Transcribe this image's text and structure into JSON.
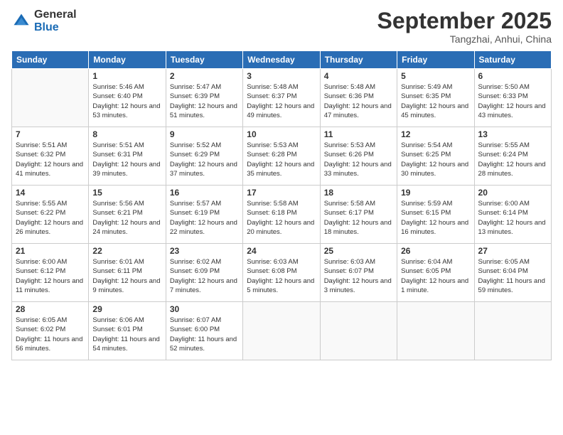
{
  "logo": {
    "general": "General",
    "blue": "Blue"
  },
  "title": "September 2025",
  "subtitle": "Tangzhai, Anhui, China",
  "days_header": [
    "Sunday",
    "Monday",
    "Tuesday",
    "Wednesday",
    "Thursday",
    "Friday",
    "Saturday"
  ],
  "weeks": [
    [
      {
        "num": "",
        "info": ""
      },
      {
        "num": "1",
        "info": "Sunrise: 5:46 AM\nSunset: 6:40 PM\nDaylight: 12 hours\nand 53 minutes."
      },
      {
        "num": "2",
        "info": "Sunrise: 5:47 AM\nSunset: 6:39 PM\nDaylight: 12 hours\nand 51 minutes."
      },
      {
        "num": "3",
        "info": "Sunrise: 5:48 AM\nSunset: 6:37 PM\nDaylight: 12 hours\nand 49 minutes."
      },
      {
        "num": "4",
        "info": "Sunrise: 5:48 AM\nSunset: 6:36 PM\nDaylight: 12 hours\nand 47 minutes."
      },
      {
        "num": "5",
        "info": "Sunrise: 5:49 AM\nSunset: 6:35 PM\nDaylight: 12 hours\nand 45 minutes."
      },
      {
        "num": "6",
        "info": "Sunrise: 5:50 AM\nSunset: 6:33 PM\nDaylight: 12 hours\nand 43 minutes."
      }
    ],
    [
      {
        "num": "7",
        "info": "Sunrise: 5:51 AM\nSunset: 6:32 PM\nDaylight: 12 hours\nand 41 minutes."
      },
      {
        "num": "8",
        "info": "Sunrise: 5:51 AM\nSunset: 6:31 PM\nDaylight: 12 hours\nand 39 minutes."
      },
      {
        "num": "9",
        "info": "Sunrise: 5:52 AM\nSunset: 6:29 PM\nDaylight: 12 hours\nand 37 minutes."
      },
      {
        "num": "10",
        "info": "Sunrise: 5:53 AM\nSunset: 6:28 PM\nDaylight: 12 hours\nand 35 minutes."
      },
      {
        "num": "11",
        "info": "Sunrise: 5:53 AM\nSunset: 6:26 PM\nDaylight: 12 hours\nand 33 minutes."
      },
      {
        "num": "12",
        "info": "Sunrise: 5:54 AM\nSunset: 6:25 PM\nDaylight: 12 hours\nand 30 minutes."
      },
      {
        "num": "13",
        "info": "Sunrise: 5:55 AM\nSunset: 6:24 PM\nDaylight: 12 hours\nand 28 minutes."
      }
    ],
    [
      {
        "num": "14",
        "info": "Sunrise: 5:55 AM\nSunset: 6:22 PM\nDaylight: 12 hours\nand 26 minutes."
      },
      {
        "num": "15",
        "info": "Sunrise: 5:56 AM\nSunset: 6:21 PM\nDaylight: 12 hours\nand 24 minutes."
      },
      {
        "num": "16",
        "info": "Sunrise: 5:57 AM\nSunset: 6:19 PM\nDaylight: 12 hours\nand 22 minutes."
      },
      {
        "num": "17",
        "info": "Sunrise: 5:58 AM\nSunset: 6:18 PM\nDaylight: 12 hours\nand 20 minutes."
      },
      {
        "num": "18",
        "info": "Sunrise: 5:58 AM\nSunset: 6:17 PM\nDaylight: 12 hours\nand 18 minutes."
      },
      {
        "num": "19",
        "info": "Sunrise: 5:59 AM\nSunset: 6:15 PM\nDaylight: 12 hours\nand 16 minutes."
      },
      {
        "num": "20",
        "info": "Sunrise: 6:00 AM\nSunset: 6:14 PM\nDaylight: 12 hours\nand 13 minutes."
      }
    ],
    [
      {
        "num": "21",
        "info": "Sunrise: 6:00 AM\nSunset: 6:12 PM\nDaylight: 12 hours\nand 11 minutes."
      },
      {
        "num": "22",
        "info": "Sunrise: 6:01 AM\nSunset: 6:11 PM\nDaylight: 12 hours\nand 9 minutes."
      },
      {
        "num": "23",
        "info": "Sunrise: 6:02 AM\nSunset: 6:09 PM\nDaylight: 12 hours\nand 7 minutes."
      },
      {
        "num": "24",
        "info": "Sunrise: 6:03 AM\nSunset: 6:08 PM\nDaylight: 12 hours\nand 5 minutes."
      },
      {
        "num": "25",
        "info": "Sunrise: 6:03 AM\nSunset: 6:07 PM\nDaylight: 12 hours\nand 3 minutes."
      },
      {
        "num": "26",
        "info": "Sunrise: 6:04 AM\nSunset: 6:05 PM\nDaylight: 12 hours\nand 1 minute."
      },
      {
        "num": "27",
        "info": "Sunrise: 6:05 AM\nSunset: 6:04 PM\nDaylight: 11 hours\nand 59 minutes."
      }
    ],
    [
      {
        "num": "28",
        "info": "Sunrise: 6:05 AM\nSunset: 6:02 PM\nDaylight: 11 hours\nand 56 minutes."
      },
      {
        "num": "29",
        "info": "Sunrise: 6:06 AM\nSunset: 6:01 PM\nDaylight: 11 hours\nand 54 minutes."
      },
      {
        "num": "30",
        "info": "Sunrise: 6:07 AM\nSunset: 6:00 PM\nDaylight: 11 hours\nand 52 minutes."
      },
      {
        "num": "",
        "info": ""
      },
      {
        "num": "",
        "info": ""
      },
      {
        "num": "",
        "info": ""
      },
      {
        "num": "",
        "info": ""
      }
    ]
  ]
}
